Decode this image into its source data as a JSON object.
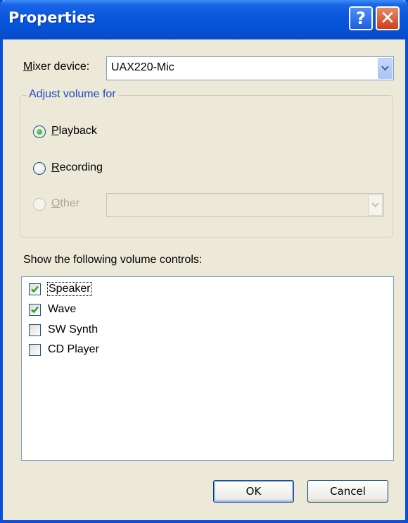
{
  "window": {
    "title": "Properties"
  },
  "titlebar": {
    "help_glyph": "?",
    "close_glyph": "✕"
  },
  "mixer": {
    "label_key": "M",
    "label_rest": "ixer device:",
    "value": "UAX220-Mic"
  },
  "adjust": {
    "legend": "Adjust volume for",
    "options": [
      {
        "key": "P",
        "rest": "layback",
        "selected": true,
        "enabled": true
      },
      {
        "key": "R",
        "rest": "ecording",
        "selected": false,
        "enabled": true
      },
      {
        "key": "O",
        "rest": "ther",
        "selected": false,
        "enabled": false
      }
    ],
    "other_value": ""
  },
  "controls": {
    "label": "Show the following volume controls:",
    "items": [
      {
        "label": "Speaker",
        "checked": true
      },
      {
        "label": "Wave",
        "checked": true
      },
      {
        "label": "SW Synth",
        "checked": false
      },
      {
        "label": "CD Player",
        "checked": false
      }
    ]
  },
  "buttons": {
    "ok": "OK",
    "cancel": "Cancel"
  },
  "colors": {
    "titlebar": "#0a56db",
    "dialog_bg": "#ece9d8",
    "legend_text": "#1f48b9",
    "check": "#21a121"
  },
  "icons": {
    "help": "help-icon",
    "close": "close-icon",
    "dropdown": "chevron-down-icon",
    "check": "checkmark-icon"
  }
}
